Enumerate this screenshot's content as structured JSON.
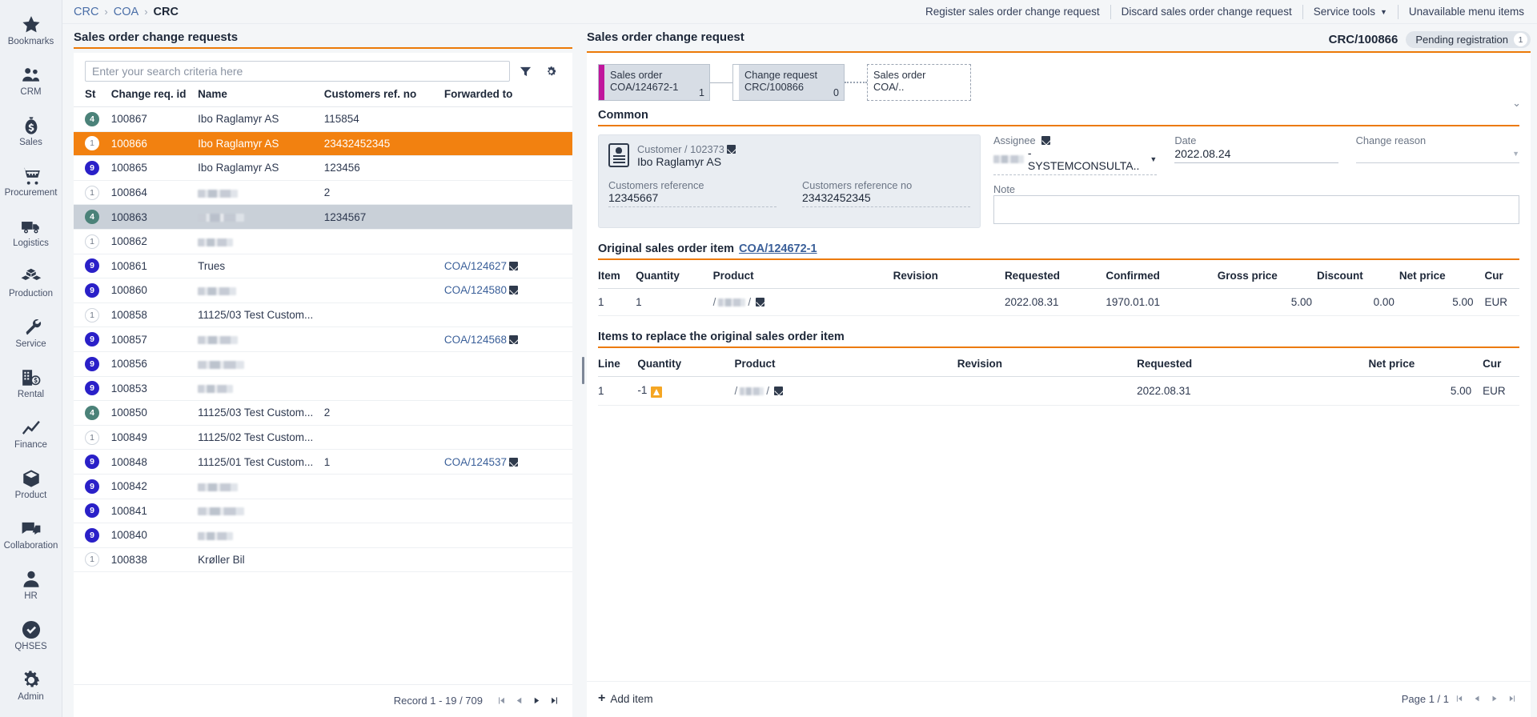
{
  "sidebar": {
    "items": [
      {
        "label": "Bookmarks",
        "icon": "star-icon"
      },
      {
        "label": "CRM",
        "icon": "people-icon"
      },
      {
        "label": "Sales",
        "icon": "money-bag-icon"
      },
      {
        "label": "Procurement",
        "icon": "shopping-cart-icon"
      },
      {
        "label": "Logistics",
        "icon": "truck-icon"
      },
      {
        "label": "Production",
        "icon": "boxes-icon"
      },
      {
        "label": "Service",
        "icon": "wrench-icon"
      },
      {
        "label": "Rental",
        "icon": "building-money-icon"
      },
      {
        "label": "Finance",
        "icon": "trend-line-icon"
      },
      {
        "label": "Product",
        "icon": "cube-icon"
      },
      {
        "label": "Collaboration",
        "icon": "chat-bubbles-icon"
      },
      {
        "label": "HR",
        "icon": "person-icon"
      },
      {
        "label": "QHSES",
        "icon": "check-shield-icon"
      },
      {
        "label": "Admin",
        "icon": "gear-icon"
      }
    ]
  },
  "breadcrumb": {
    "items": [
      "CRC",
      "COA",
      "CRC"
    ],
    "separator": "›"
  },
  "top_actions": [
    {
      "label": "Register sales order change request",
      "caret": false
    },
    {
      "label": "Discard sales order change request",
      "caret": false
    },
    {
      "label": "Service tools",
      "caret": true
    },
    {
      "label": "Unavailable menu items",
      "caret": false
    }
  ],
  "list_panel": {
    "title": "Sales order change requests",
    "search": {
      "value": "",
      "placeholder": "Enter your search criteria here"
    },
    "toolbar_icons": [
      "filter-icon",
      "gear-icon"
    ],
    "columns": [
      "St",
      "Change req. id",
      "Name",
      "Customers ref. no",
      "Forwarded to"
    ],
    "rows": [
      {
        "st": "4",
        "st_kind": "b4",
        "id": "100867",
        "name": "Ibo Raglamyr AS",
        "name_redacted": false,
        "ref": "115854",
        "fwd": "",
        "state": "normal"
      },
      {
        "st": "1",
        "st_kind": "b1",
        "id": "100866",
        "name": "Ibo Raglamyr AS",
        "name_redacted": false,
        "ref": "23432452345",
        "fwd": "",
        "state": "selected"
      },
      {
        "st": "9",
        "st_kind": "b9",
        "id": "100865",
        "name": "Ibo Raglamyr AS",
        "name_redacted": false,
        "ref": "123456",
        "fwd": "",
        "state": "normal"
      },
      {
        "st": "1",
        "st_kind": "b1",
        "id": "100864",
        "name": "",
        "name_redacted": true,
        "ref": "2",
        "fwd": "",
        "state": "normal"
      },
      {
        "st": "4",
        "st_kind": "b4",
        "id": "100863",
        "name": "",
        "name_redacted": true,
        "ref": "1234567",
        "fwd": "",
        "state": "highlight"
      },
      {
        "st": "1",
        "st_kind": "b1",
        "id": "100862",
        "name": "",
        "name_redacted": true,
        "ref": "",
        "fwd": "",
        "state": "normal"
      },
      {
        "st": "9",
        "st_kind": "b9",
        "id": "100861",
        "name": "Trues",
        "name_redacted": false,
        "ref": "",
        "fwd": "COA/124627",
        "state": "normal"
      },
      {
        "st": "9",
        "st_kind": "b9",
        "id": "100860",
        "name": "",
        "name_redacted": true,
        "ref": "",
        "fwd": "COA/124580",
        "state": "normal"
      },
      {
        "st": "1",
        "st_kind": "b1",
        "id": "100858",
        "name": "11125/03 Test Custom...",
        "name_redacted": false,
        "ref": "",
        "fwd": "",
        "state": "normal"
      },
      {
        "st": "9",
        "st_kind": "b9",
        "id": "100857",
        "name": "",
        "name_redacted": true,
        "ref": "",
        "fwd": "COA/124568",
        "state": "normal"
      },
      {
        "st": "9",
        "st_kind": "b9",
        "id": "100856",
        "name": "",
        "name_redacted": true,
        "ref": "",
        "fwd": "",
        "state": "normal"
      },
      {
        "st": "9",
        "st_kind": "b9",
        "id": "100853",
        "name": "",
        "name_redacted": true,
        "ref": "",
        "fwd": "",
        "state": "normal"
      },
      {
        "st": "4",
        "st_kind": "b4",
        "id": "100850",
        "name": "11125/03 Test Custom...",
        "name_redacted": false,
        "ref": "2",
        "fwd": "",
        "state": "normal"
      },
      {
        "st": "1",
        "st_kind": "b1",
        "id": "100849",
        "name": "11125/02 Test Custom...",
        "name_redacted": false,
        "ref": "",
        "fwd": "",
        "state": "normal"
      },
      {
        "st": "9",
        "st_kind": "b9",
        "id": "100848",
        "name": "11125/01 Test Custom...",
        "name_redacted": false,
        "ref": "1",
        "fwd": "COA/124537",
        "state": "normal"
      },
      {
        "st": "9",
        "st_kind": "b9",
        "id": "100842",
        "name": "",
        "name_redacted": true,
        "ref": "",
        "fwd": "",
        "state": "normal"
      },
      {
        "st": "9",
        "st_kind": "b9",
        "id": "100841",
        "name": "",
        "name_redacted": true,
        "ref": "",
        "fwd": "",
        "state": "normal"
      },
      {
        "st": "9",
        "st_kind": "b9",
        "id": "100840",
        "name": "",
        "name_redacted": true,
        "ref": "",
        "fwd": "",
        "state": "normal"
      },
      {
        "st": "1",
        "st_kind": "b1",
        "id": "100838",
        "name": "Krøller Bil",
        "name_redacted": false,
        "ref": "",
        "fwd": "",
        "state": "normal"
      }
    ],
    "footer": {
      "record_info": "Record 1 - 19 / 709"
    }
  },
  "detail_panel": {
    "title": "Sales order change request",
    "record_id": "CRC/100866",
    "status_pill": {
      "label": "Pending registration",
      "count": "1"
    },
    "workflow": [
      {
        "type": "Sales order",
        "id": "COA/124672-1",
        "count": "1",
        "bar_color": "#c0169c",
        "ghost": false
      },
      {
        "type": "Change request",
        "id": "CRC/100866",
        "count": "0",
        "bar_color": "#ffffff",
        "ghost": false
      },
      {
        "type": "Sales order",
        "id": "COA/..",
        "count": "",
        "bar_color": "",
        "ghost": true
      }
    ],
    "common": {
      "title": "Common",
      "customer_label": "Customer / 102373",
      "customer_name": "Ibo Raglamyr AS",
      "fields": [
        {
          "label": "Customers reference",
          "value": "12345667"
        },
        {
          "label": "Customers reference no",
          "value": "23432452345"
        }
      ],
      "assignee": {
        "label": "Assignee",
        "value": "- SYSTEMCONSULTA..",
        "redacted_prefix": true
      },
      "date": {
        "label": "Date",
        "value": "2022.08.24"
      },
      "change_reason": {
        "label": "Change reason",
        "value": ""
      },
      "note": {
        "label": "Note",
        "value": ""
      }
    },
    "original_item": {
      "title": "Original sales order item",
      "link": "COA/124672-1",
      "columns": [
        "Item",
        "Quantity",
        "Product",
        "Revision",
        "Requested",
        "Confirmed",
        "Gross price",
        "Discount",
        "Net price",
        "Cur"
      ],
      "rows": [
        {
          "item": "1",
          "quantity": "1",
          "product": "/ ... /",
          "product_redacted": true,
          "revision": "",
          "requested": "2022.08.31",
          "confirmed": "1970.01.01",
          "gross_price": "5.00",
          "discount": "0.00",
          "net_price": "5.00",
          "cur": "EUR"
        }
      ]
    },
    "replace_items": {
      "title": "Items to replace the original sales order item",
      "columns": [
        "Line",
        "Quantity",
        "Product",
        "Revision",
        "Requested",
        "Net price",
        "Cur"
      ],
      "rows": [
        {
          "line": "1",
          "quantity": "-1",
          "quantity_warning": true,
          "product": "/ ... /",
          "product_redacted": true,
          "revision": "",
          "requested": "2022.08.31",
          "net_price": "5.00",
          "cur": "EUR"
        }
      ],
      "add_label": "Add item",
      "page_info": "Page 1 / 1"
    }
  },
  "colors": {
    "accent_orange": "#ec7a08",
    "selected_row": "#f28110",
    "badge_blue": "#2a20c8",
    "badge_teal": "#4b8279",
    "rail_bg": "#eef1f5",
    "panel_bg": "#f4f6f8",
    "workflow_node": "#d7dde5",
    "workflow_magenta": "#c0169c",
    "warning": "#f5a623"
  }
}
